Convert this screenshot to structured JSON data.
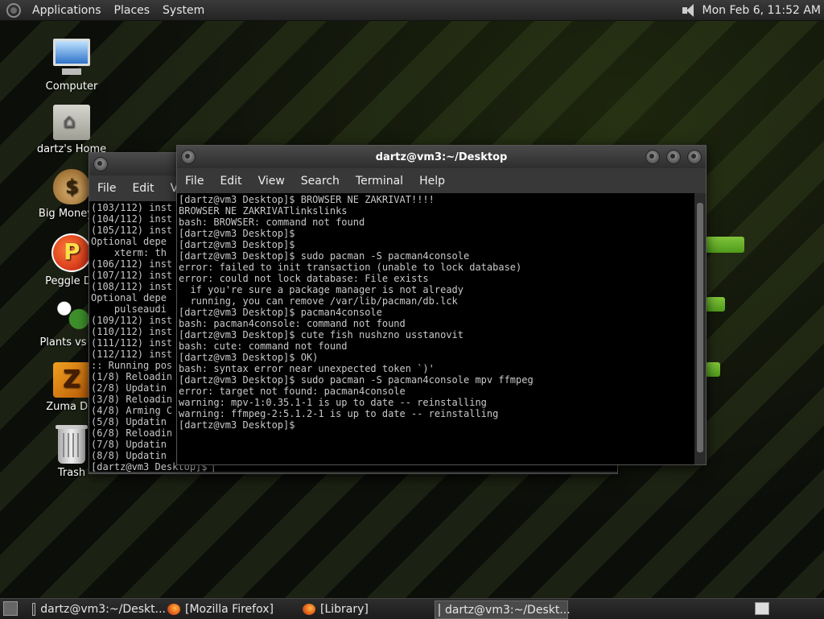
{
  "top_panel": {
    "menus": [
      "Applications",
      "Places",
      "System"
    ],
    "clock": "Mon Feb  6, 11:52 AM"
  },
  "desktop_icons": [
    {
      "label": "Computer",
      "icon": "computer-icon"
    },
    {
      "label": "dartz's Home",
      "icon": "home-folder-icon"
    },
    {
      "label": "Big Money D",
      "icon": "big-money-icon"
    },
    {
      "label": "Peggle De",
      "icon": "peggle-icon"
    },
    {
      "label": "Plants vs Zo",
      "icon": "plants-vs-zombies-icon"
    },
    {
      "label": "Zuma Del",
      "icon": "zuma-icon"
    },
    {
      "label": "Trash",
      "icon": "trash-icon"
    }
  ],
  "back_terminal": {
    "menu": [
      "File",
      "Edit",
      "Vi"
    ],
    "lines": [
      "(103/112) inst",
      "(104/112) inst",
      "(105/112) inst",
      "Optional depe",
      "    xterm: th",
      "(106/112) inst",
      "(107/112) inst",
      "(108/112) inst",
      "Optional depe",
      "    pulseaudi",
      "(109/112) inst",
      "(110/112) inst",
      "(111/112) inst",
      "(112/112) inst",
      ":: Running pos",
      "(1/8) Reloadin",
      "(2/8) Updatin",
      "(3/8) Reloadin",
      "(4/8) Arming C",
      "(5/8) Updatin",
      "(6/8) Reloadin",
      "(7/8) Updatin",
      "(8/8) Updatin",
      "[dartz@vm3 Desktop]$ ▏"
    ]
  },
  "front_terminal": {
    "title": "dartz@vm3:~/Desktop",
    "menu": [
      "File",
      "Edit",
      "View",
      "Search",
      "Terminal",
      "Help"
    ],
    "lines": [
      "[dartz@vm3 Desktop]$ BROWSER NE ZAKRIVAT!!!!",
      "BROWSER NE ZAKRIVATlinkslinks",
      "bash: BROWSER: command not found",
      "[dartz@vm3 Desktop]$",
      "[dartz@vm3 Desktop]$",
      "[dartz@vm3 Desktop]$ sudo pacman -S pacman4console",
      "error: failed to init transaction (unable to lock database)",
      "error: could not lock database: File exists",
      "  if you're sure a package manager is not already",
      "  running, you can remove /var/lib/pacman/db.lck",
      "[dartz@vm3 Desktop]$ pacman4console",
      "bash: pacman4console: command not found",
      "[dartz@vm3 Desktop]$ cute fish nushzno usstanovit",
      "bash: cute: command not found",
      "[dartz@vm3 Desktop]$ OK)",
      "bash: syntax error near unexpected token `)'",
      "[dartz@vm3 Desktop]$ sudo pacman -S pacman4console mpv ffmpeg",
      "error: target not found: pacman4console",
      "warning: mpv-1:0.35.1-1 is up to date -- reinstalling",
      "warning: ffmpeg-2:5.1.2-1 is up to date -- reinstalling",
      "[dartz@vm3 Desktop]$"
    ]
  },
  "taskbar": [
    {
      "label": "dartz@vm3:~/Deskt...",
      "icon": "terminal-icon",
      "active": false
    },
    {
      "label": "[Mozilla Firefox]",
      "icon": "firefox-icon",
      "active": false
    },
    {
      "label": "[Library]",
      "icon": "firefox-icon",
      "active": false
    },
    {
      "label": "dartz@vm3:~/Deskt...",
      "icon": "terminal-icon",
      "active": true
    }
  ]
}
